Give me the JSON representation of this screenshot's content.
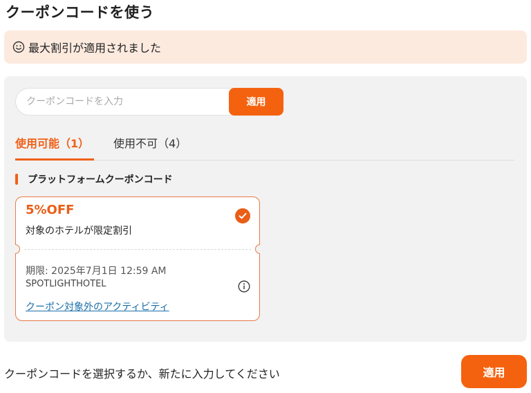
{
  "page": {
    "title": "クーポンコードを使う"
  },
  "banner": {
    "icon": "smiley-icon",
    "text": "最大割引が適用されました"
  },
  "search": {
    "placeholder": "クーポンコードを入力",
    "value": "",
    "apply_label": "適用"
  },
  "tabs": [
    {
      "label": "使用可能",
      "count": "（1）",
      "active": true
    },
    {
      "label": "使用不可",
      "count": "（4）",
      "active": false
    }
  ],
  "section": {
    "title": "プラットフォームクーポンコード"
  },
  "coupon": {
    "discount": "5%OFF",
    "description": "対象のホテルが限定割引",
    "expiry": "期限: 2025年7月1日 12:59 AM",
    "code": "SPOTLIGHTHOTEL",
    "excluded_link": "クーポン対象外のアクティビティ",
    "selected": true
  },
  "footer": {
    "text": "クーポンコードを選択するか、新たに入力してください",
    "apply_label": "適用"
  },
  "colors": {
    "accent": "#f5620f",
    "banner_bg": "#fdeadf",
    "panel_bg": "#f2f2f2",
    "link": "#1a6ea8"
  }
}
